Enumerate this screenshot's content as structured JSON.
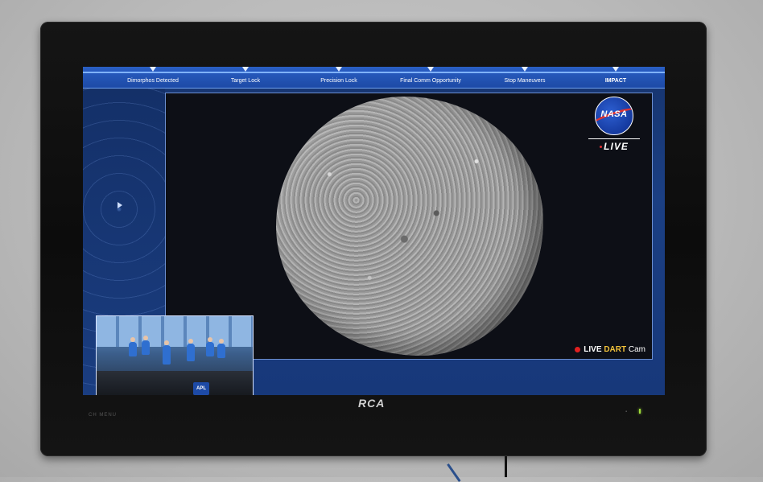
{
  "timeline": {
    "labels": [
      "Dimorphos Detected",
      "Target Lock",
      "Precision Lock",
      "Final Comm Opportunity",
      "Stop Maneuvers",
      "IMPACT"
    ]
  },
  "feed": {
    "nasa_logo_text": "NASA",
    "live_badge": "LIVE",
    "cam_live": "LIVE",
    "cam_name": "DART",
    "cam_suffix": "Cam"
  },
  "pip": {
    "logo_text": "APL"
  },
  "tv": {
    "brand": "RCA",
    "small_label": "CH  MENU"
  },
  "colors": {
    "timeline_bg": "#1d4aa6",
    "screen_bg": "#17387a",
    "live_dot": "#e02020",
    "dart_text": "#f2c23a"
  }
}
